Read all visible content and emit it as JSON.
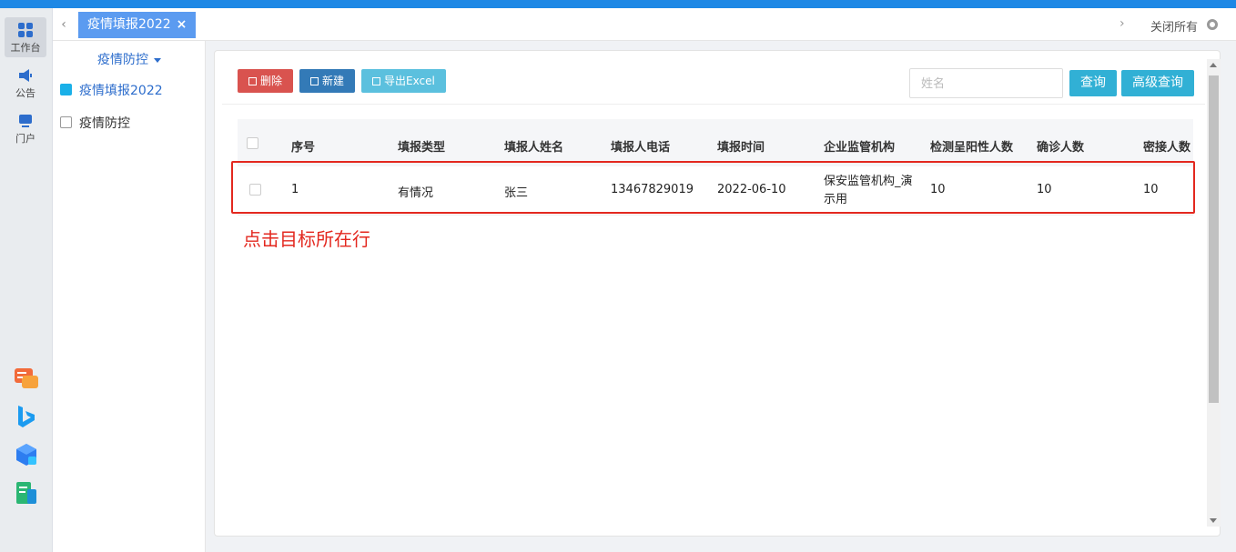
{
  "rail": {
    "items": [
      {
        "label": "工作台",
        "icon": "grid-icon"
      },
      {
        "label": "公告",
        "icon": "megaphone-icon"
      },
      {
        "label": "门户",
        "icon": "monitor-icon"
      }
    ],
    "apps": [
      "chat-app-icon",
      "bing-app-icon",
      "cube-app-icon",
      "doc-app-icon"
    ]
  },
  "tabbar": {
    "active_tab": "疫情填报2022",
    "close_all": "关闭所有"
  },
  "sidebar": {
    "title": "疫情防控",
    "items": [
      {
        "label": "疫情填报2022"
      },
      {
        "label": "疫情防控"
      }
    ]
  },
  "toolbar": {
    "delete": "删除",
    "new": "新建",
    "export": "导出Excel",
    "search_placeholder": "姓名",
    "query": "查询",
    "advanced_query": "高级查询"
  },
  "table": {
    "columns": [
      "序号",
      "填报类型",
      "填报人姓名",
      "填报人电话",
      "填报时间",
      "企业监管机构",
      "检测呈阳性人数",
      "确诊人数",
      "密接人数"
    ],
    "rows": [
      [
        "1",
        "有情况",
        "张三",
        "13467829019",
        "2022-06-10",
        "保安监管机构_演示用",
        "10",
        "10",
        "10"
      ]
    ]
  },
  "annotation": {
    "hint": "点击目标所在行",
    "color": "#e3281f"
  },
  "colors": {
    "accent": "#1e88e5",
    "tab": "#5b9bf0",
    "danger": "#d9534f",
    "primary": "#337ab7",
    "info": "#5bc0de"
  }
}
